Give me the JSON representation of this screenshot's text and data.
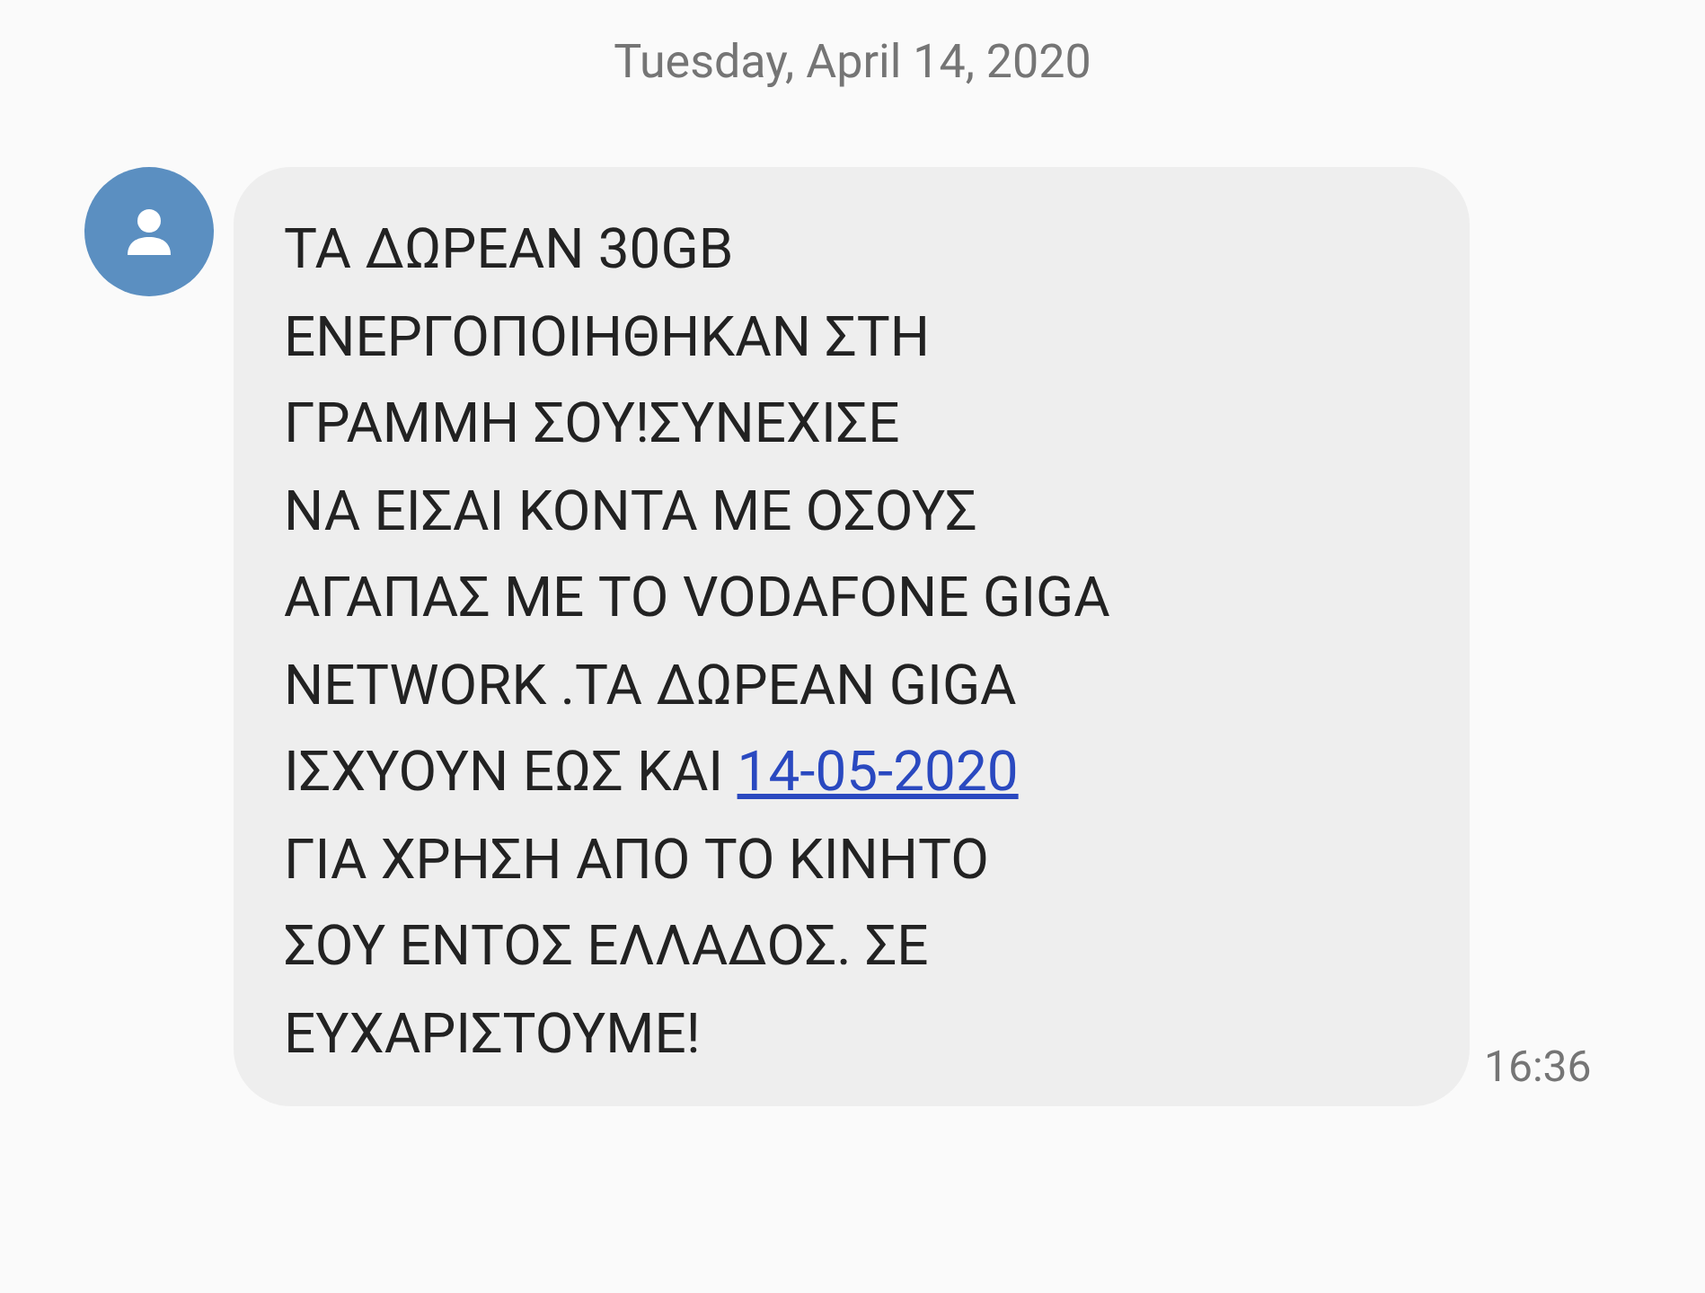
{
  "date_header": "Tuesday, April 14, 2020",
  "messages": [
    {
      "kind": "incoming",
      "time": "16:36",
      "lines": [
        [
          {
            "kind": "text",
            "text": "ΤΑ ΔΩΡΕΑΝ 30GB"
          }
        ],
        [
          {
            "kind": "text",
            "text": "ΕΝΕΡΓΟΠΟΙΗΘΗΚΑΝ ΣΤΗ"
          }
        ],
        [
          {
            "kind": "text",
            "text": "ΓΡΑΜΜΗ ΣΟΥ!ΣΥΝΕΧΙΣΕ"
          }
        ],
        [
          {
            "kind": "text",
            "text": "ΝΑ ΕΙΣΑΙ ΚΟΝΤΑ ΜΕ ΟΣΟΥΣ"
          }
        ],
        [
          {
            "kind": "text",
            "text": "ΑΓΑΠΑΣ ΜΕ ΤΟ VODAFONE GIGA"
          }
        ],
        [
          {
            "kind": "text",
            "text": "NETWORK .ΤΑ ΔΩΡΕΑΝ GIGA"
          }
        ],
        [
          {
            "kind": "text",
            "text": "ΙΣΧΥΟΥΝ ΕΩΣ ΚΑΙ "
          },
          {
            "kind": "link",
            "text": "14-05-2020"
          }
        ],
        [
          {
            "kind": "text",
            "text": "ΓΙΑ ΧΡΗΣΗ ΑΠΟ ΤΟ ΚΙΝΗΤΟ"
          }
        ],
        [
          {
            "kind": "text",
            "text": "ΣΟΥ ΕΝΤΟΣ ΕΛΛΑΔΟΣ. ΣΕ"
          }
        ],
        [
          {
            "kind": "text",
            "text": "ΕΥΧΑΡΙΣΤΟΥΜΕ!"
          }
        ]
      ]
    }
  ]
}
